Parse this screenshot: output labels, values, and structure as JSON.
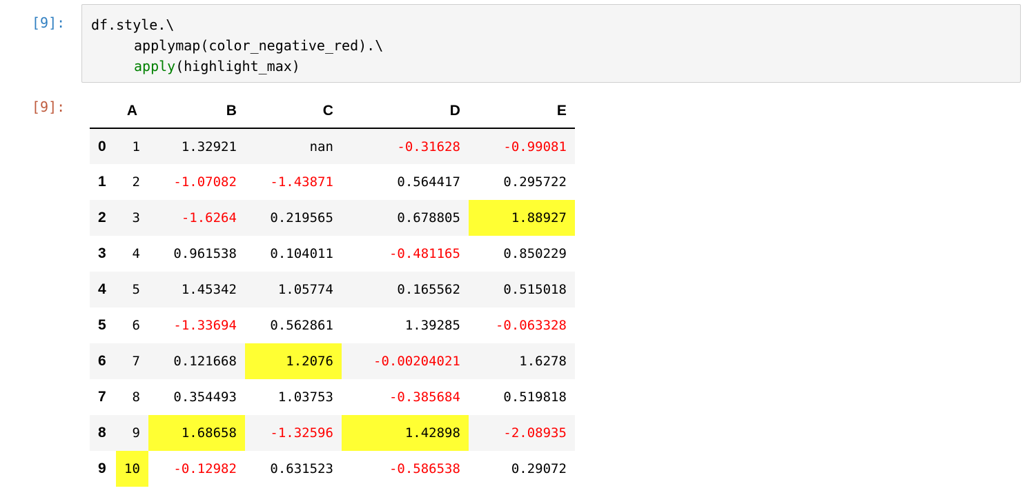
{
  "cell": {
    "input_prompt": "[9]:",
    "output_prompt": "[9]:",
    "code_lines": [
      {
        "indent": false,
        "plain": "df.style.\\",
        "builtin": ""
      },
      {
        "indent": true,
        "plain": "applymap(color_negative_red).\\",
        "builtin": ""
      },
      {
        "indent": true,
        "builtin": "apply",
        "plain": "(highlight_max)"
      }
    ]
  },
  "colors": {
    "negative": "#ff0000",
    "highlight": "#ffff33",
    "input_prompt": "#307fc1",
    "output_prompt": "#bf5b3d",
    "builtin": "#008000"
  },
  "table": {
    "columns": [
      "A",
      "B",
      "C",
      "D",
      "E"
    ],
    "rows": [
      {
        "index": "0",
        "cells": [
          {
            "v": "1",
            "neg": false,
            "hl": false
          },
          {
            "v": "1.32921",
            "neg": false,
            "hl": false
          },
          {
            "v": "nan",
            "neg": false,
            "hl": false
          },
          {
            "v": "-0.31628",
            "neg": true,
            "hl": false
          },
          {
            "v": "-0.99081",
            "neg": true,
            "hl": false
          }
        ]
      },
      {
        "index": "1",
        "cells": [
          {
            "v": "2",
            "neg": false,
            "hl": false
          },
          {
            "v": "-1.07082",
            "neg": true,
            "hl": false
          },
          {
            "v": "-1.43871",
            "neg": true,
            "hl": false
          },
          {
            "v": "0.564417",
            "neg": false,
            "hl": false
          },
          {
            "v": "0.295722",
            "neg": false,
            "hl": false
          }
        ]
      },
      {
        "index": "2",
        "cells": [
          {
            "v": "3",
            "neg": false,
            "hl": false
          },
          {
            "v": "-1.6264",
            "neg": true,
            "hl": false
          },
          {
            "v": "0.219565",
            "neg": false,
            "hl": false
          },
          {
            "v": "0.678805",
            "neg": false,
            "hl": false
          },
          {
            "v": "1.88927",
            "neg": false,
            "hl": true
          }
        ]
      },
      {
        "index": "3",
        "cells": [
          {
            "v": "4",
            "neg": false,
            "hl": false
          },
          {
            "v": "0.961538",
            "neg": false,
            "hl": false
          },
          {
            "v": "0.104011",
            "neg": false,
            "hl": false
          },
          {
            "v": "-0.481165",
            "neg": true,
            "hl": false
          },
          {
            "v": "0.850229",
            "neg": false,
            "hl": false
          }
        ]
      },
      {
        "index": "4",
        "cells": [
          {
            "v": "5",
            "neg": false,
            "hl": false
          },
          {
            "v": "1.45342",
            "neg": false,
            "hl": false
          },
          {
            "v": "1.05774",
            "neg": false,
            "hl": false
          },
          {
            "v": "0.165562",
            "neg": false,
            "hl": false
          },
          {
            "v": "0.515018",
            "neg": false,
            "hl": false
          }
        ]
      },
      {
        "index": "5",
        "cells": [
          {
            "v": "6",
            "neg": false,
            "hl": false
          },
          {
            "v": "-1.33694",
            "neg": true,
            "hl": false
          },
          {
            "v": "0.562861",
            "neg": false,
            "hl": false
          },
          {
            "v": "1.39285",
            "neg": false,
            "hl": false
          },
          {
            "v": "-0.063328",
            "neg": true,
            "hl": false
          }
        ]
      },
      {
        "index": "6",
        "cells": [
          {
            "v": "7",
            "neg": false,
            "hl": false
          },
          {
            "v": "0.121668",
            "neg": false,
            "hl": false
          },
          {
            "v": "1.2076",
            "neg": false,
            "hl": true
          },
          {
            "v": "-0.00204021",
            "neg": true,
            "hl": false
          },
          {
            "v": "1.6278",
            "neg": false,
            "hl": false
          }
        ]
      },
      {
        "index": "7",
        "cells": [
          {
            "v": "8",
            "neg": false,
            "hl": false
          },
          {
            "v": "0.354493",
            "neg": false,
            "hl": false
          },
          {
            "v": "1.03753",
            "neg": false,
            "hl": false
          },
          {
            "v": "-0.385684",
            "neg": true,
            "hl": false
          },
          {
            "v": "0.519818",
            "neg": false,
            "hl": false
          }
        ]
      },
      {
        "index": "8",
        "cells": [
          {
            "v": "9",
            "neg": false,
            "hl": false
          },
          {
            "v": "1.68658",
            "neg": false,
            "hl": true
          },
          {
            "v": "-1.32596",
            "neg": true,
            "hl": false
          },
          {
            "v": "1.42898",
            "neg": false,
            "hl": true
          },
          {
            "v": "-2.08935",
            "neg": true,
            "hl": false
          }
        ]
      },
      {
        "index": "9",
        "cells": [
          {
            "v": "10",
            "neg": false,
            "hl": true
          },
          {
            "v": "-0.12982",
            "neg": true,
            "hl": false
          },
          {
            "v": "0.631523",
            "neg": false,
            "hl": false
          },
          {
            "v": "-0.586538",
            "neg": true,
            "hl": false
          },
          {
            "v": "0.29072",
            "neg": false,
            "hl": false
          }
        ]
      }
    ]
  }
}
